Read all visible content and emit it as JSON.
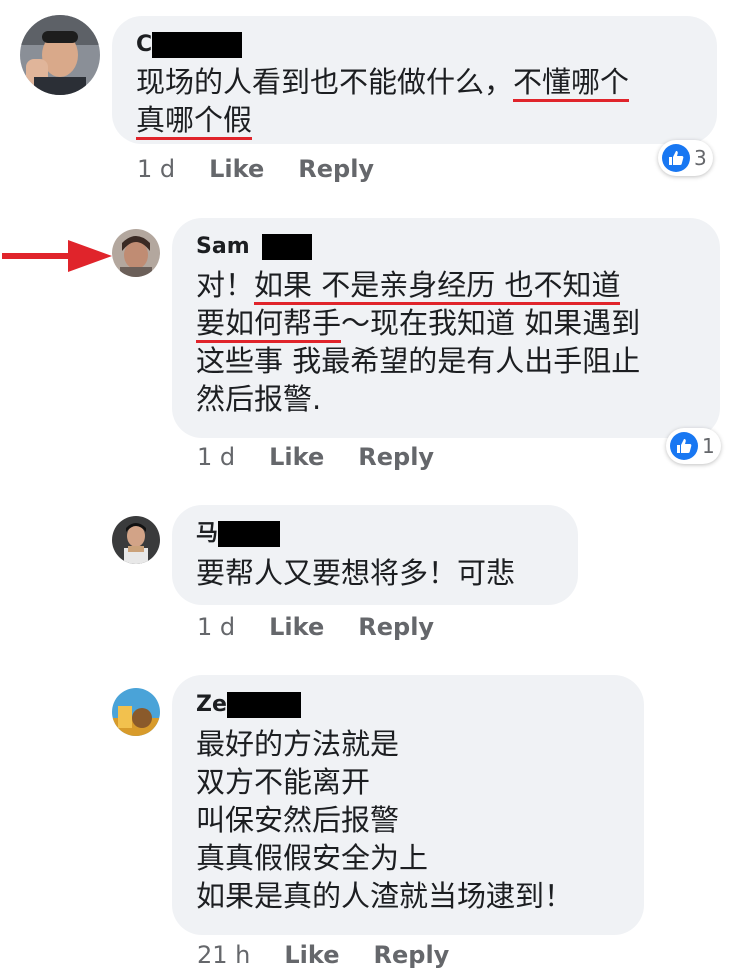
{
  "comments": [
    {
      "name": "C",
      "lines": [
        [
          {
            "t": "现场的人看到也不能做什么，"
          },
          {
            "t": "不懂哪个",
            "u": true
          }
        ],
        [
          {
            "t": "真哪个假",
            "u": true
          }
        ]
      ],
      "time": "1 d",
      "like_label": "Like",
      "reply_label": "Reply",
      "reaction_count": "3"
    },
    {
      "name": "Sam",
      "lines": [
        [
          {
            "t": "对！"
          },
          {
            "t": "如果 不是亲身经历 也不知道",
            "u": true
          }
        ],
        [
          {
            "t": "要如何帮手",
            "u": true
          },
          {
            "t": "～现在我知道 如果遇到"
          }
        ],
        [
          {
            "t": "这些事 我最希望的是有人出手阻止"
          }
        ],
        [
          {
            "t": "然后报警."
          }
        ]
      ],
      "time": "1 d",
      "like_label": "Like",
      "reply_label": "Reply",
      "reaction_count": "1"
    },
    {
      "name": "马",
      "lines": [
        [
          {
            "t": "要帮人又要想将多！可悲"
          }
        ]
      ],
      "time": "1 d",
      "like_label": "Like",
      "reply_label": "Reply"
    },
    {
      "name": "Ze",
      "lines": [
        [
          {
            "t": "最好的方法就是"
          }
        ],
        [
          {
            "t": "双方不能离开"
          }
        ],
        [
          {
            "t": "叫保安然后报警"
          }
        ],
        [
          {
            "t": "真真假假安全为上"
          }
        ],
        [
          {
            "t": "如果是真的人渣就当场逮到！"
          }
        ]
      ],
      "time": "21 h",
      "like_label": "Like",
      "reply_label": "Reply"
    }
  ],
  "colors": {
    "bubble": "#f0f2f5",
    "underline": "#e0242b",
    "arrow": "#e0242b",
    "like_blue": "#1877f2",
    "meta_text": "#65676b"
  },
  "icons": {
    "reaction": "like-thumb-icon",
    "annotation": "red-arrow-icon"
  }
}
